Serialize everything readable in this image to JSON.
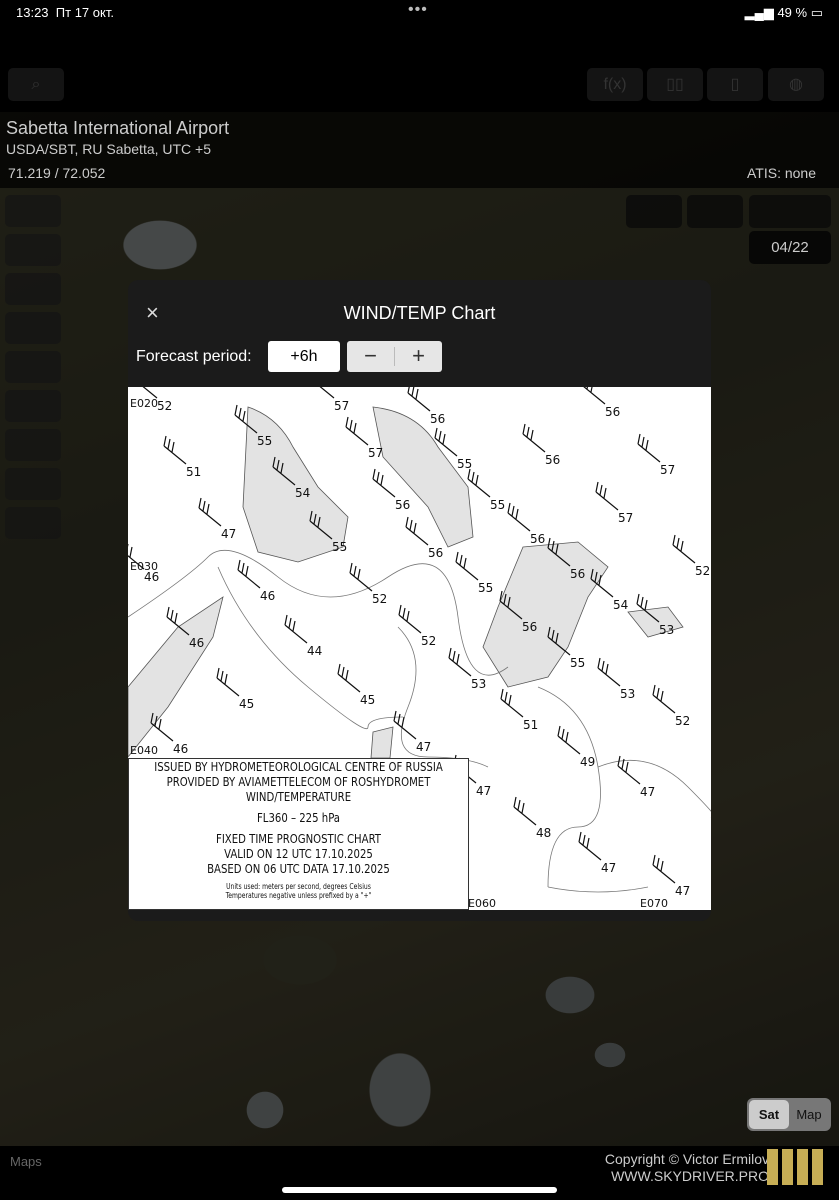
{
  "status": {
    "time": "13:23",
    "date": "Пт 17 окт.",
    "battery": "49 %"
  },
  "toolbar": {
    "icons": [
      "search-icon",
      "function-icon",
      "book-icon",
      "document-icon",
      "globe-icon"
    ]
  },
  "airport": {
    "name": "Sabetta International Airport",
    "codes": "USDA/SBT, RU Sabetta, UTC +5",
    "coords": "71.219 / 72.052",
    "atis": "ATIS: none"
  },
  "runway": "04/22",
  "modal": {
    "title": "WIND/TEMP Chart",
    "close": "×",
    "forecast_label": "Forecast period:",
    "forecast_value": "+6h",
    "minus": "−",
    "plus": "+"
  },
  "chart": {
    "legend": [
      "ISSUED BY HYDROMETEOROLOGICAL CENTRE OF RUSSIA",
      "PROVIDED BY AVIAMETTELECOM OF ROSHYDROMET",
      "WIND/TEMPERATURE",
      "FL360 – 225 hPa",
      "FIXED TIME PROGNOSTIC CHART",
      "VALID ON 12 UTC 17.10.2025",
      "BASED ON 06 UTC DATA 17.10.2025",
      "Units used: meters per second, degrees Celsius",
      "Temperatures negative unless prefixed by a \"+\""
    ],
    "meridians": [
      "E020",
      "E030",
      "E040",
      "E060",
      "E070"
    ],
    "temperatures": [
      "52",
      "57",
      "56",
      "56",
      "55",
      "57",
      "55",
      "56",
      "57",
      "51",
      "54",
      "56",
      "55",
      "57",
      "47",
      "55",
      "56",
      "56",
      "56",
      "52",
      "46",
      "46",
      "52",
      "55",
      "54",
      "53",
      "56",
      "46",
      "52",
      "44",
      "55",
      "53",
      "53",
      "45",
      "45",
      "51",
      "52",
      "46",
      "47",
      "49",
      "47",
      "47",
      "48",
      "47",
      "47"
    ]
  },
  "map_toggle": {
    "sat": "Sat",
    "map": "Map",
    "selected": "Sat"
  },
  "footer": {
    "maps": "Maps",
    "copyright": "Copyright © Victor Ermilov",
    "site": "WWW.SKYDRIVER.PRO"
  },
  "colors": {
    "logo": "#c7ae55",
    "modal_bg": "#1b1b1b"
  }
}
